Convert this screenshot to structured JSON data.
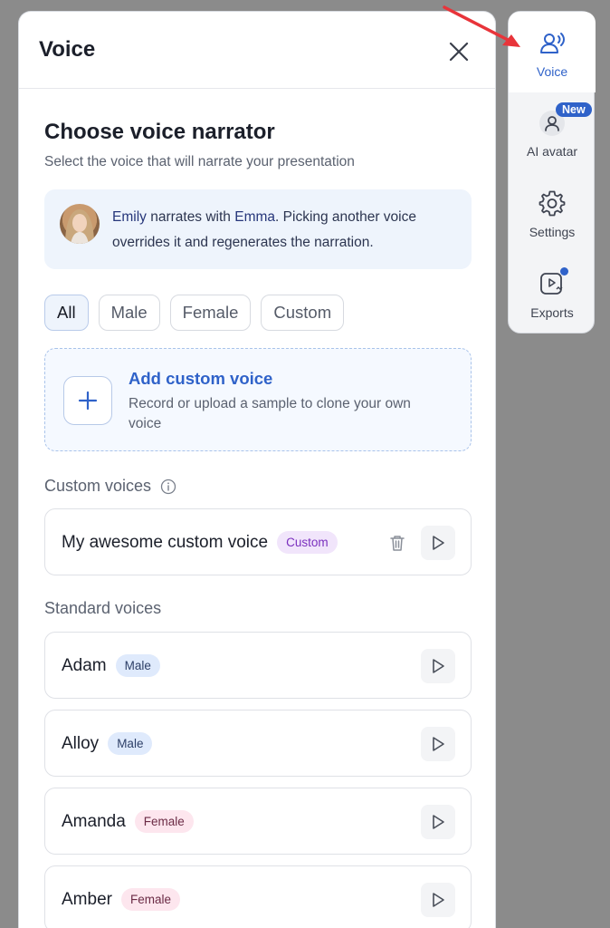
{
  "panel": {
    "title": "Voice",
    "heading": "Choose voice narrator",
    "subheading": "Select the voice that will narrate your presentation",
    "info": {
      "avatar_name": "Emily",
      "middle": " narrates with ",
      "voice_name": "Emma",
      "rest": ". Picking another voice overrides it and regenerates the narration."
    },
    "filters": [
      "All",
      "Male",
      "Female",
      "Custom"
    ],
    "add_custom": {
      "title": "Add custom voice",
      "description": "Record or upload a sample to clone your own voice"
    },
    "custom_section_label": "Custom voices",
    "custom_voices": [
      {
        "name": "My awesome custom voice",
        "tag": "Custom"
      }
    ],
    "standard_section_label": "Standard voices",
    "standard_voices": [
      {
        "name": "Adam",
        "tag": "Male"
      },
      {
        "name": "Alloy",
        "tag": "Male"
      },
      {
        "name": "Amanda",
        "tag": "Female"
      },
      {
        "name": "Amber",
        "tag": "Female"
      }
    ]
  },
  "rail": {
    "voice": "Voice",
    "ai_avatar": "AI avatar",
    "new_badge": "New",
    "settings": "Settings",
    "exports": "Exports"
  },
  "colors": {
    "accent": "#2f62c9",
    "arrow": "#e8343a"
  }
}
